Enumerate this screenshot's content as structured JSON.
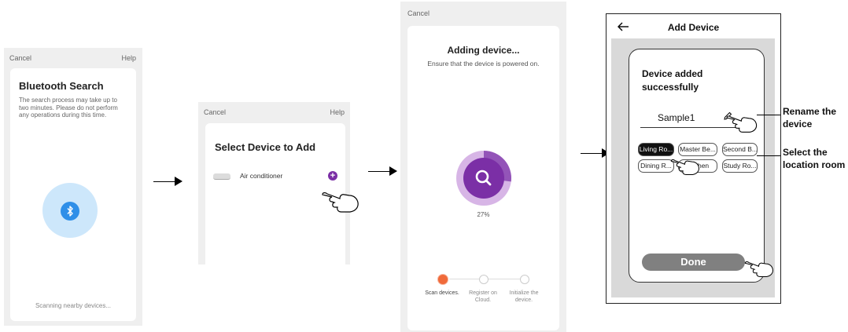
{
  "screen1": {
    "cancel": "Cancel",
    "help": "Help",
    "title": "Bluetooth Search",
    "description": "The search process may take up to two minutes. Please do not perform any operations during this time.",
    "status": "Scanning nearby devices...",
    "accent": "#2f8fe8"
  },
  "screen2": {
    "cancel": "Cancel",
    "help": "Help",
    "title": "Select Device to Add",
    "device_name": "Air conditioner",
    "accent": "#7b2fa6"
  },
  "screen3": {
    "cancel": "Cancel",
    "title": "Adding device...",
    "subtitle": "Ensure that the device is powered on.",
    "progress_text": "27%",
    "progress_value": 27,
    "steps": [
      "Scan devices.",
      "Register on Cloud.",
      "Initialize the device."
    ],
    "accent": "#7b2fa6",
    "step_active_color": "#f06a3a"
  },
  "screen4": {
    "title": "Add Device",
    "success_text": "Device added successfully",
    "device_name": "Sample1",
    "rooms": [
      "Living Ro...",
      "Master Be...",
      "Second B...",
      "Dining R...",
      "Kitchen",
      "Study Ro..."
    ],
    "done_label": "Done"
  },
  "annotations": {
    "rename": "Rename the device",
    "location": "Select the location room"
  }
}
